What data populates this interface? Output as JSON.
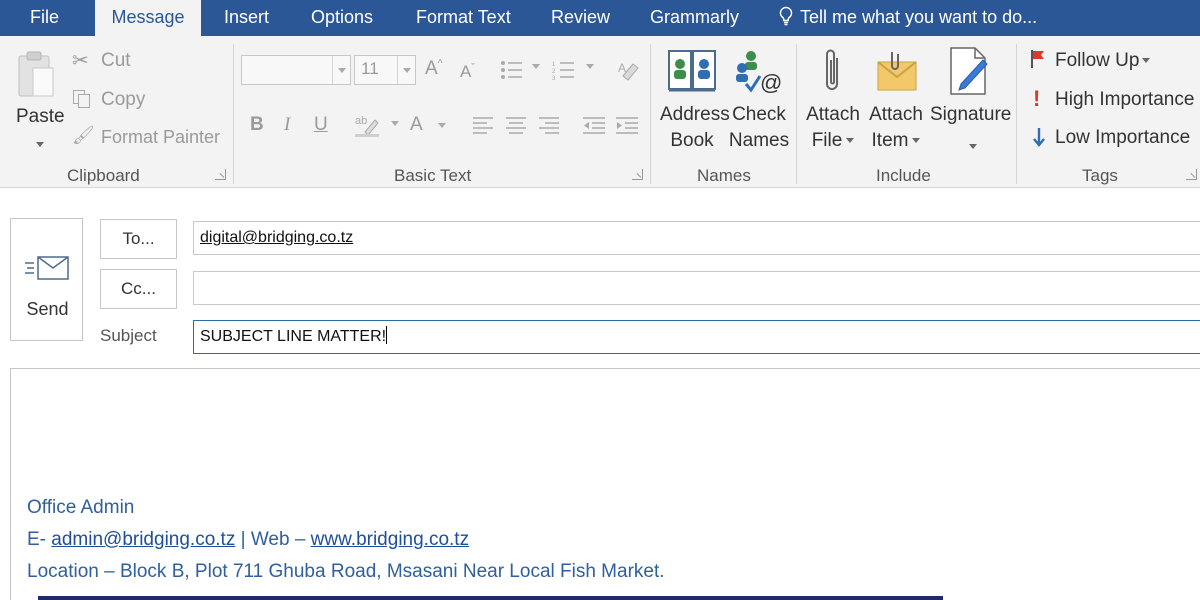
{
  "tabs": [
    {
      "label": "File",
      "active": false
    },
    {
      "label": "Message",
      "active": true
    },
    {
      "label": "Insert",
      "active": false
    },
    {
      "label": "Options",
      "active": false
    },
    {
      "label": "Format Text",
      "active": false
    },
    {
      "label": "Review",
      "active": false
    },
    {
      "label": "Grammarly",
      "active": false
    }
  ],
  "tell_me": "Tell me what you want to do...",
  "clipboard": {
    "paste": "Paste",
    "cut": "Cut",
    "copy": "Copy",
    "format_painter": "Format Painter",
    "group": "Clipboard"
  },
  "basic_text": {
    "font_name": "",
    "font_size": "11",
    "grow_font": "A",
    "shrink_font": "A",
    "bold": "B",
    "italic": "I",
    "underline": "U",
    "font_color": "A",
    "group": "Basic Text"
  },
  "names": {
    "address_book": [
      "Address",
      "Book"
    ],
    "check_names": [
      "Check",
      "Names"
    ],
    "group": "Names"
  },
  "include": {
    "attach_file": [
      "Attach",
      "File"
    ],
    "attach_item": [
      "Attach",
      "Item"
    ],
    "signature": "Signature",
    "group": "Include"
  },
  "tags": {
    "follow_up": "Follow Up",
    "high_importance": "High Importance",
    "low_importance": "Low Importance",
    "group": "Tags"
  },
  "compose": {
    "send": "Send",
    "to_button": "To...",
    "cc_button": "Cc...",
    "subject_label": "Subject",
    "to_value": "digital@bridging.co.tz",
    "cc_value": "",
    "subject_value": "SUBJECT LINE MATTER!"
  },
  "signature_block": {
    "name": "Office Admin",
    "email_prefix": "E- ",
    "email": "admin@bridging.co.tz",
    "web_prefix": " | Web – ",
    "web": "www.bridging.co.tz",
    "location": "Location – Block B, Plot 711 Ghuba Road, Msasani Near Local Fish Market."
  },
  "colors": {
    "tabbar": "#2b5797",
    "ribbon": "#f3f3f3",
    "signature_text": "#2e5f9e",
    "importance_red": "#d83b2b",
    "low_importance_blue": "#2f6db5"
  }
}
